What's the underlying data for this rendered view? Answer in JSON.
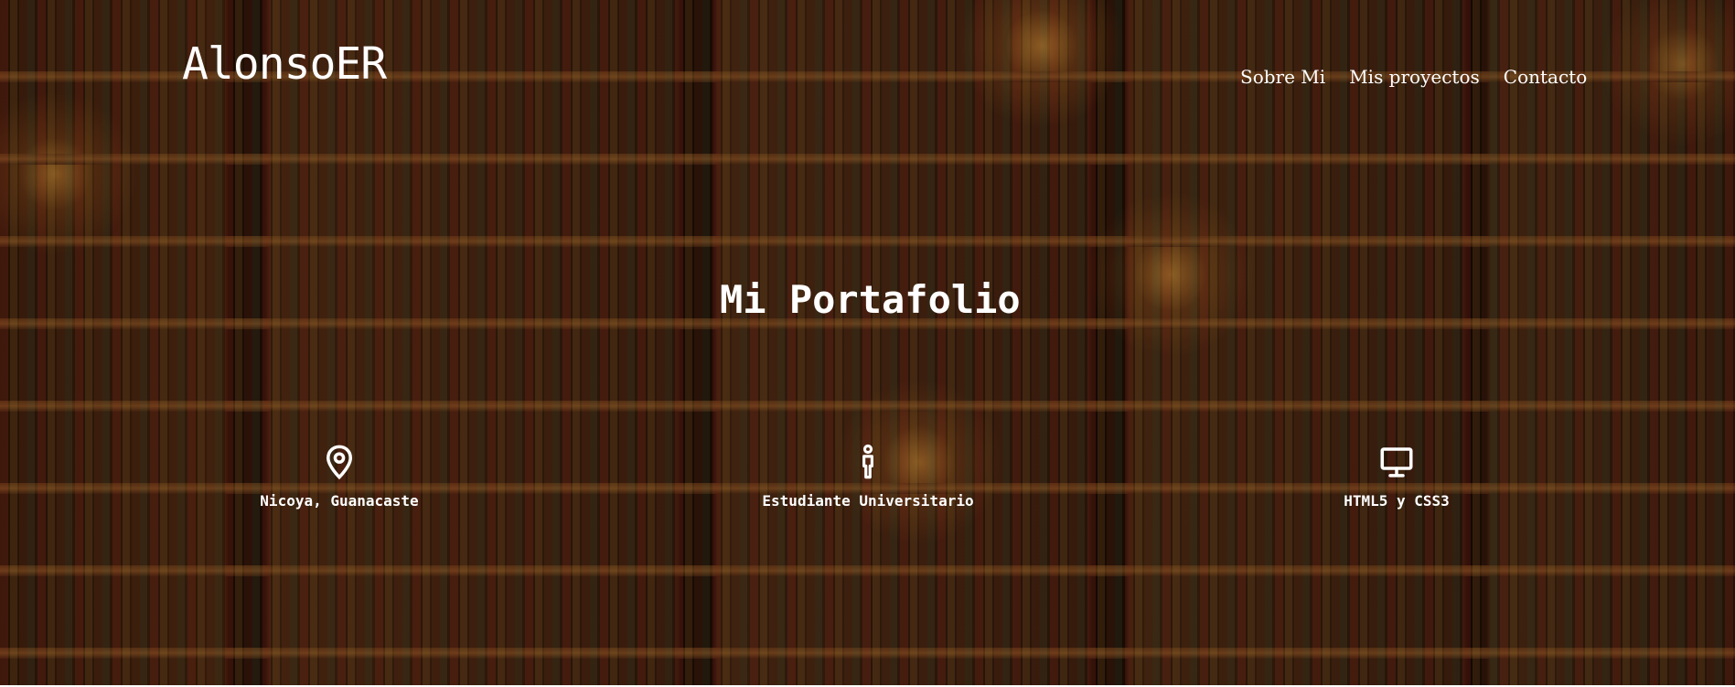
{
  "header": {
    "brand": "AlonsoER",
    "nav": [
      {
        "label": "Sobre Mi"
      },
      {
        "label": "Mis proyectos"
      },
      {
        "label": "Contacto"
      }
    ]
  },
  "hero": {
    "title": "Mi Portafolio",
    "features": [
      {
        "icon": "location-pin-icon",
        "label": "Nicoya, Guanacaste"
      },
      {
        "icon": "person-icon",
        "label": "Estudiante Universitario"
      },
      {
        "icon": "monitor-icon",
        "label": "HTML5 y CSS3"
      }
    ]
  },
  "colors": {
    "text": "#ffffff",
    "background_dark": "#2a1608"
  }
}
